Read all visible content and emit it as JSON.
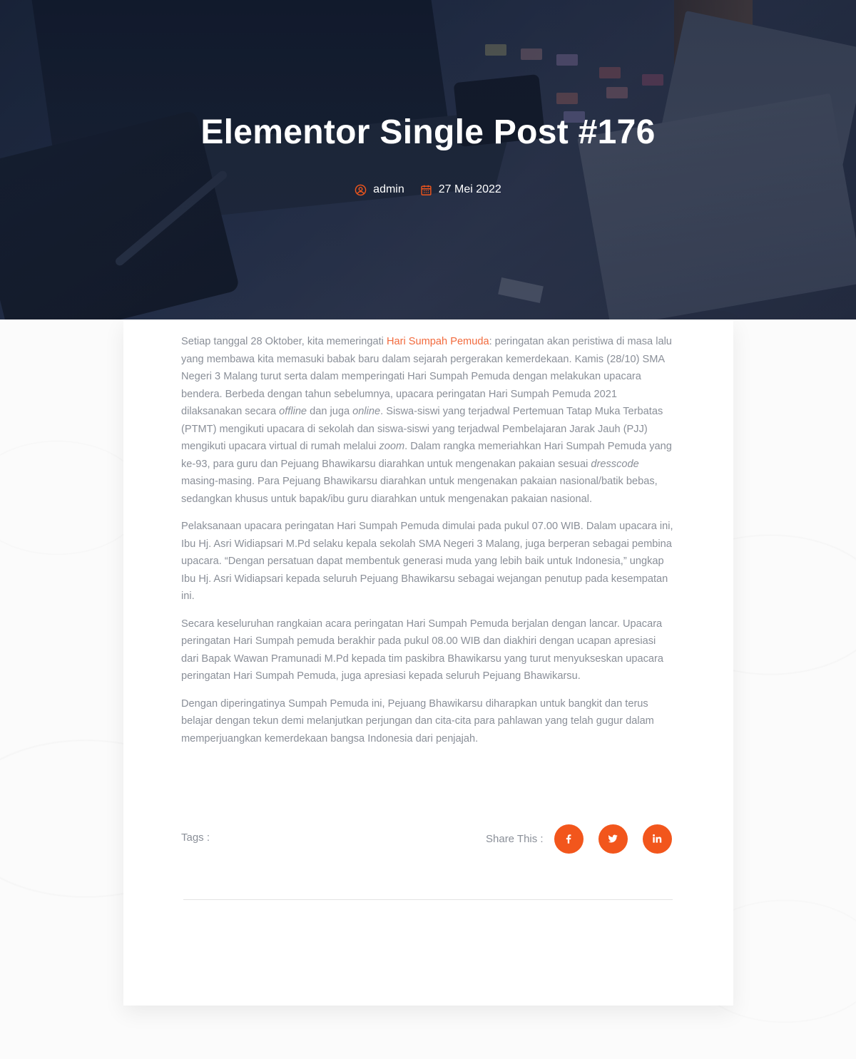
{
  "hero": {
    "title": "Elementor Single Post #176",
    "author": "admin",
    "date": "27 Mei 2022",
    "author_icon": "user-circle-icon",
    "date_icon": "calendar-icon"
  },
  "article": {
    "p1_a": "Setiap tanggal 28 Oktober, kita memeringati ",
    "p1_link": "Hari Sumpah Pemuda",
    "p1_b": ": peringatan akan peristiwa di masa lalu yang membawa kita memasuki babak baru dalam sejarah pergerakan kemerdekaan. Kamis (28/10) SMA Negeri 3 Malang turut serta dalam memperingati Hari Sumpah Pemuda dengan melakukan upacara bendera. Berbeda dengan tahun sebelumnya, upacara peringatan Hari Sumpah Pemuda 2021 dilaksanakan secara ",
    "p1_em1": "offline",
    "p1_c": " dan juga ",
    "p1_em2": "online",
    "p1_d": ". Siswa-siswi yang terjadwal Pertemuan Tatap Muka Terbatas (PTMT) mengikuti upacara di sekolah dan siswa-siswi yang terjadwal Pembelajaran Jarak Jauh (PJJ) mengikuti upacara virtual di rumah melalui ",
    "p1_em3": "zoom",
    "p1_e": ". Dalam rangka memeriahkan Hari Sumpah Pemuda yang ke-93, para guru dan Pejuang Bhawikarsu diarahkan untuk mengenakan pakaian sesuai ",
    "p1_em4": "dresscode",
    "p1_f": " masing-masing. Para Pejuang Bhawikarsu diarahkan untuk mengenakan pakaian nasional/batik bebas, sedangkan khusus untuk bapak/ibu guru diarahkan untuk mengenakan pakaian nasional.",
    "p2": "Pelaksanaan upacara peringatan Hari Sumpah Pemuda dimulai pada pukul 07.00 WIB. Dalam upacara ini, Ibu Hj. Asri Widiapsari M.Pd selaku kepala sekolah SMA Negeri 3 Malang, juga berperan sebagai pembina upacara. “Dengan persatuan dapat membentuk generasi muda yang lebih baik untuk Indonesia,” ungkap Ibu Hj. Asri Widiapsari kepada seluruh Pejuang Bhawikarsu sebagai wejangan penutup pada kesempatan ini.",
    "p3": "Secara keseluruhan rangkaian acara peringatan Hari Sumpah Pemuda berjalan dengan lancar. Upacara peringatan Hari Sumpah pemuda berakhir pada pukul 08.00 WIB dan diakhiri dengan ucapan apresiasi dari Bapak Wawan Pramunadi M.Pd kepada tim paskibra Bhawikarsu yang turut menyukseskan upacara peringatan Hari Sumpah Pemuda, juga apresiasi kepada seluruh Pejuang Bhawikarsu.",
    "p4": "Dengan diperingatinya Sumpah Pemuda ini, Pejuang Bhawikarsu diharapkan untuk bangkit dan terus belajar dengan tekun demi melanjutkan perjungan dan cita-cita para pahlawan yang telah gugur dalam memperjuangkan kemerdekaan bangsa Indonesia dari penjajah."
  },
  "footer": {
    "tags_label": "Tags :",
    "share_label": "Share This :",
    "social": [
      {
        "icon": "facebook-icon"
      },
      {
        "icon": "twitter-icon"
      },
      {
        "icon": "linkedin-icon"
      }
    ]
  },
  "colors": {
    "accent": "#f2561c",
    "link": "#f26a3d",
    "body_text": "#8a8f98",
    "hero_overlay": "#1e2a44"
  }
}
